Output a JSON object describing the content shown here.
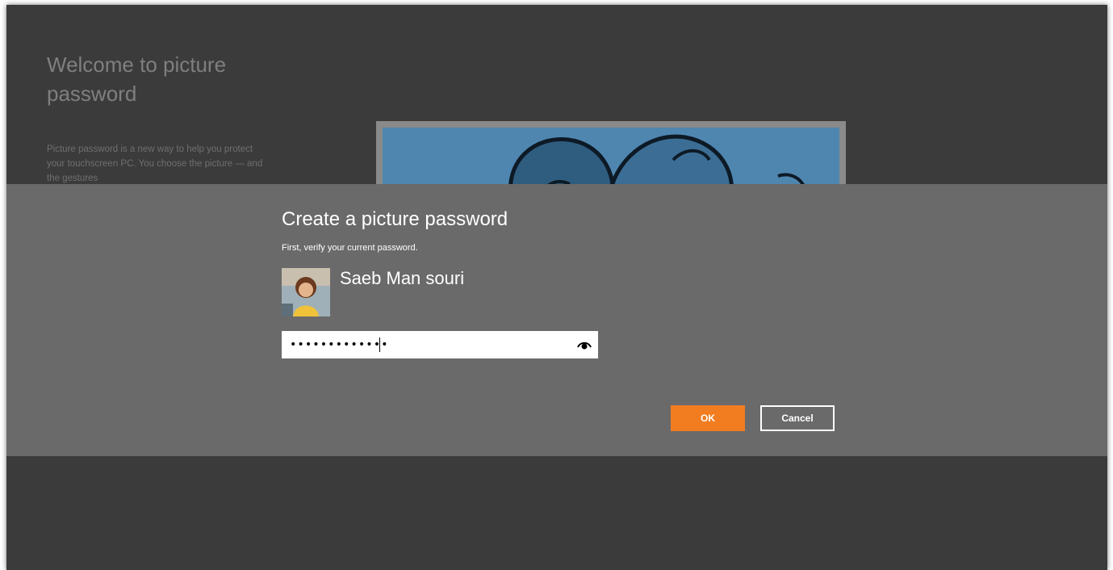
{
  "intro": {
    "title": "Welcome to picture password",
    "body": "Picture password is a new way to help you protect your touchscreen PC. You choose the picture — and the gestures"
  },
  "dialog": {
    "title": "Create a picture password",
    "subtitle": "First, verify your current password.",
    "user_name": "Saeb Man souri",
    "password_value": "•••••••••••••",
    "reveal_icon": "eye-icon",
    "ok_label": "OK",
    "cancel_label": "Cancel"
  },
  "colors": {
    "background": "#3b3b3b",
    "overlay": "#6a6a6a",
    "accent": "#f27d21",
    "picture_blue": "#4f86b0"
  }
}
